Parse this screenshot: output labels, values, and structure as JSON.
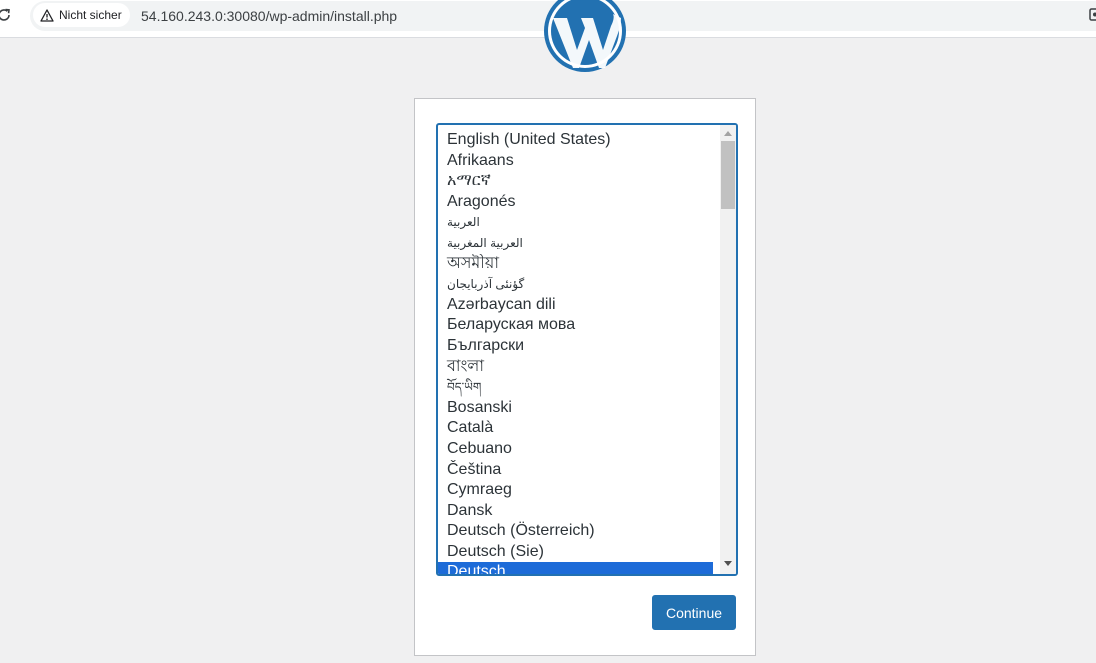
{
  "browser": {
    "security_label": "Nicht sicher",
    "url": "54.160.243.0:30080/wp-admin/install.php"
  },
  "language_select": {
    "options": [
      "English (United States)",
      "Afrikaans",
      "አማርኛ",
      "Aragonés",
      "العربية",
      "العربية المغربية",
      "অসমীয়া",
      "گؤنئی آذربایجان",
      "Azərbaycan dili",
      "Беларуская мова",
      "Български",
      "বাংলা",
      "བོད་ཡིག",
      "Bosanski",
      "Català",
      "Cebuano",
      "Čeština",
      "Cymraeg",
      "Dansk",
      "Deutsch (Österreich)",
      "Deutsch (Sie)",
      "Deutsch"
    ],
    "selected": "Deutsch"
  },
  "continue_label": "Continue",
  "colors": {
    "accent": "#2271b1",
    "selected_bg": "#1d6bd8",
    "page_bg": "#f0f0f1"
  }
}
